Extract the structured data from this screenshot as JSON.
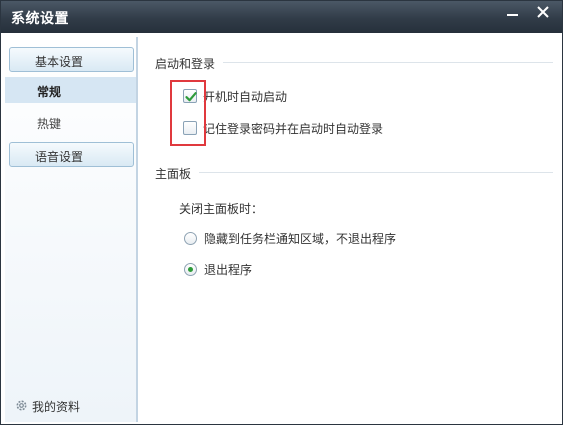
{
  "window": {
    "title": "系统设置",
    "minimize_icon": "minimize-icon",
    "close_icon": "close-icon"
  },
  "sidebar": {
    "groups": [
      {
        "label": "基本设置",
        "items": [
          {
            "label": "常规",
            "selected": true
          },
          {
            "label": "热键",
            "selected": false
          }
        ]
      },
      {
        "label": "语音设置",
        "items": []
      }
    ],
    "profile": {
      "icon": "gear-icon",
      "label": "我的资料"
    }
  },
  "startup": {
    "title": "启动和登录",
    "options": [
      {
        "label": "开机时自动启动",
        "checked": true
      },
      {
        "label": "记住登录密码并在启动时自动登录",
        "checked": false
      }
    ]
  },
  "main_panel": {
    "title": "主面板",
    "question": "关闭主面板时：",
    "options": [
      {
        "label": "隐藏到任务栏通知区域，不退出程序",
        "selected": false
      },
      {
        "label": "退出程序",
        "selected": true
      }
    ]
  },
  "colors": {
    "highlight_box": "#e0393e",
    "check_mark": "#2e9b3a",
    "titlebar": "#313c48"
  }
}
